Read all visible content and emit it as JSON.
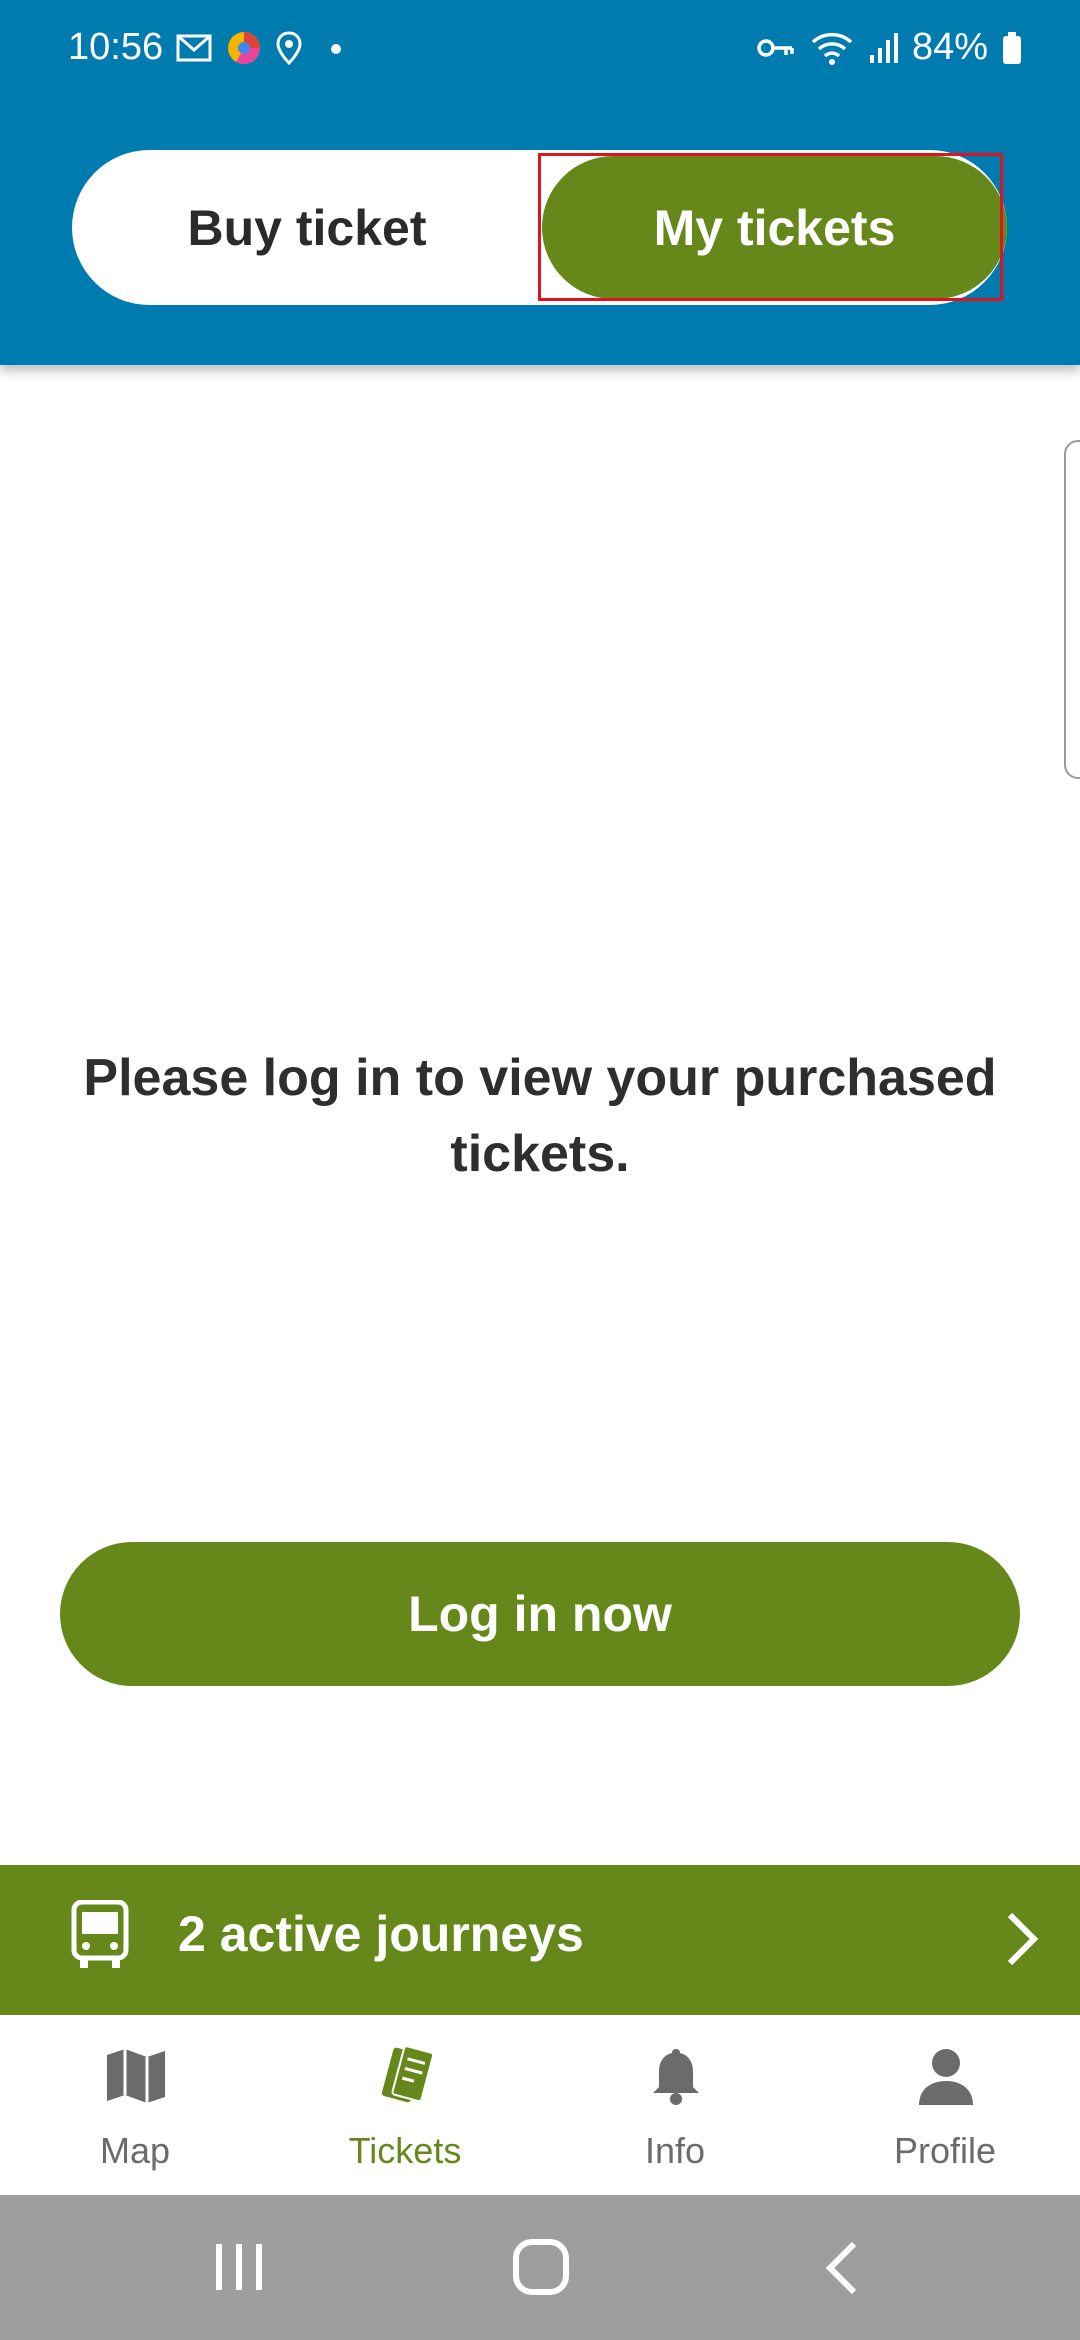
{
  "status_bar": {
    "time": "10:56",
    "battery": "84%",
    "icons_left": [
      "mail-icon",
      "browser-icon",
      "location-icon",
      "dot-icon"
    ],
    "icons_right": [
      "vpn-key-icon",
      "wifi-icon",
      "signal-icon",
      "battery-icon"
    ]
  },
  "header": {
    "toggle": {
      "buy_ticket_label": "Buy ticket",
      "my_tickets_label": "My tickets",
      "selected": "My tickets"
    }
  },
  "main": {
    "message": "Please log in to view your purchased tickets.",
    "login_button_label": "Log in now"
  },
  "journeys_bar": {
    "label": "2 active journeys",
    "icon": "bus-icon"
  },
  "bottom_nav": {
    "items": [
      {
        "label": "Map",
        "icon": "map-icon",
        "active": false
      },
      {
        "label": "Tickets",
        "icon": "tickets-icon",
        "active": true
      },
      {
        "label": "Info",
        "icon": "bell-icon",
        "active": false
      },
      {
        "label": "Profile",
        "icon": "person-icon",
        "active": false
      }
    ]
  },
  "colors": {
    "header_blue": "#007bb0",
    "accent_green": "#66881b",
    "text_dark": "#2e2e2e",
    "nav_gray": "#6b6b6b",
    "system_nav_gray": "#9e9e9e",
    "highlight_red": "#e0141e"
  }
}
